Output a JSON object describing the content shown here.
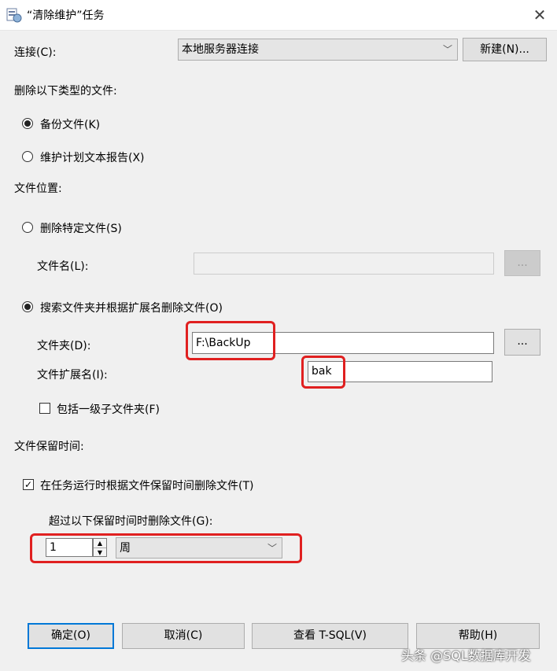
{
  "window": {
    "title": "“清除维护”任务",
    "close_glyph": "✕"
  },
  "connection": {
    "label": "连接(C):",
    "value": "本地服务器连接",
    "new_button": "新建(N)..."
  },
  "delete_types": {
    "heading": "删除以下类型的文件:",
    "option_backup": "备份文件(K)",
    "option_report": "维护计划文本报告(X)",
    "selected": "备份文件(K)"
  },
  "file_location": {
    "heading": "文件位置:",
    "option_specific": "删除特定文件(S)",
    "filename_label": "文件名(L):",
    "filename_value": "",
    "browse_file": "...",
    "option_search": "搜索文件夹并根据扩展名删除文件(O)",
    "selected": "搜索文件夹并根据扩展名删除文件(O)",
    "folder_label": "文件夹(D):",
    "folder_value": "F:\\BackUp",
    "browse_folder": "...",
    "extension_label": "文件扩展名(I):",
    "extension_value": "bak",
    "include_subfolder": "包括一级子文件夹(F)",
    "include_subfolder_checked": false
  },
  "retention": {
    "heading": "文件保留时间:",
    "delete_by_age": "在任务运行时根据文件保留时间删除文件(T)",
    "delete_by_age_checked": true,
    "older_than_label": "超过以下保留时间时删除文件(G):",
    "amount": "1",
    "unit": "周"
  },
  "buttons": {
    "ok": "确定(O)",
    "cancel": "取消(C)",
    "view_tsql": "查看 T-SQL(V)",
    "help": "帮助(H)"
  },
  "watermark": "头条 @SQL数据库开发",
  "highlight_color": "#e02020"
}
